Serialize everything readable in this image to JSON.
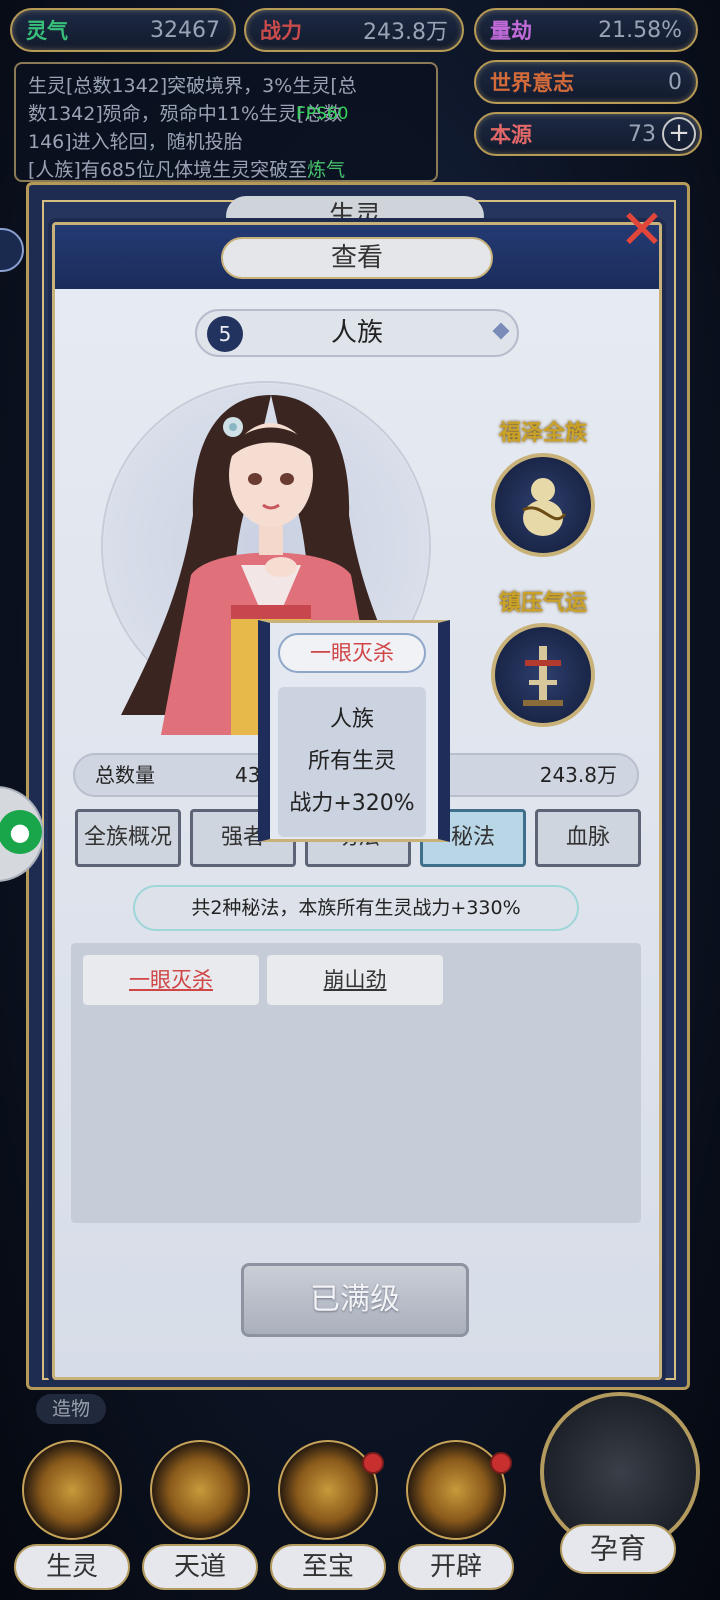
{
  "top_stats": {
    "lingqi": {
      "label": "灵气",
      "value": "32467"
    },
    "zhanli": {
      "label": "战力",
      "value": "243.8万"
    },
    "liangjie": {
      "label": "量劫",
      "value": "21.58%"
    },
    "shijie": {
      "label": "世界意志",
      "value": "0"
    },
    "benyuan": {
      "label": "本源",
      "value": "73"
    }
  },
  "log": {
    "line1": "生灵[总数1342]突破境界，3%生灵[总",
    "line2": "数1342]殒命，殒命中11%生灵[总数",
    "line3": "146]进入轮回，随机投胎",
    "line4_prefix": "[人族]有685位凡体境生灵突破至",
    "line4_hl": "炼气"
  },
  "fps": "FPS60",
  "back_title": "生灵",
  "modal": {
    "title": "查看",
    "race_number": "5",
    "race_name": "人族",
    "buffs": [
      {
        "label": "福泽全族",
        "icon": "gourd-icon"
      },
      {
        "label": "镇压气运",
        "icon": "tower-icon"
      }
    ],
    "stats": {
      "count_label": "总数量",
      "count_value": "43",
      "power_value": "243.8万"
    },
    "tabs": [
      "全族概况",
      "强者",
      "功法",
      "秘法",
      "血脉"
    ],
    "active_tab": "秘法",
    "summary": "共2种秘法，本族所有生灵战力+330%",
    "skills": [
      "一眼灭杀",
      "崩山劲"
    ],
    "maxed_button": "已满级"
  },
  "tooltip": {
    "title": "一眼灭杀",
    "line1": "人族",
    "line2": "所有生灵",
    "line3": "战力+320%"
  },
  "bottom_nav": {
    "zaowu": "造物",
    "items": [
      "生灵",
      "天道",
      "至宝",
      "开辟"
    ],
    "breed": "孕育"
  },
  "colors": {
    "accent_gold": "#c8b27a",
    "navy": "#1f2d5a",
    "skill_red": "#d04545"
  }
}
